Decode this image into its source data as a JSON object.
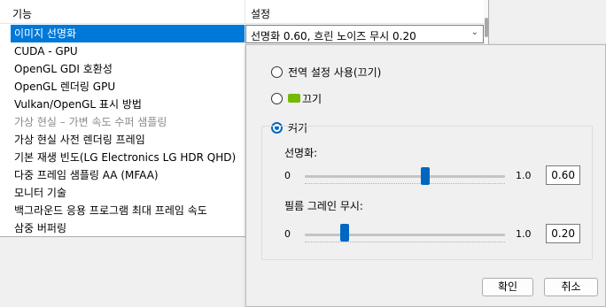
{
  "grid": {
    "col_name": "기능",
    "col_value": "설정",
    "rows": [
      {
        "label": "이미지 선명화",
        "state": "selected"
      },
      {
        "label": "CUDA - GPU",
        "state": "normal"
      },
      {
        "label": "OpenGL GDI 호환성",
        "state": "normal"
      },
      {
        "label": "OpenGL 렌더링 GPU",
        "state": "normal"
      },
      {
        "label": "Vulkan/OpenGL 표시 방법",
        "state": "normal"
      },
      {
        "label": "가상 현실 – 가변 속도 수퍼 샘플링",
        "state": "disabled"
      },
      {
        "label": "가상 현실 사전 렌더링 프레임",
        "state": "normal"
      },
      {
        "label": "기본 재생 빈도(LG Electronics LG HDR QHD)",
        "state": "normal"
      },
      {
        "label": "다중 프레임 샘플링 AA (MFAA)",
        "state": "normal"
      },
      {
        "label": "모니터 기술",
        "state": "normal"
      },
      {
        "label": "백그라운드 응용 프로그램 최대 프레임 속도",
        "state": "normal"
      },
      {
        "label": "삼중 버퍼링",
        "state": "normal"
      }
    ],
    "selected_value": "선명화 0.60, 흐린 노이즈 무시 0.20",
    "dropdown_icon": "chevron-down-icon"
  },
  "popup": {
    "options": [
      {
        "label": "전역 설정 사용(끄기)",
        "checked": false
      },
      {
        "label": "끄기",
        "checked": false,
        "icon": "nvidia-logo-icon"
      },
      {
        "label": "켜기",
        "checked": true
      }
    ],
    "sharpen": {
      "label": "선명화:",
      "min": "0",
      "max": "1.0",
      "value": "0.60",
      "level": 0.6
    },
    "grain": {
      "label": "필름 그레인 무시:",
      "min": "0",
      "max": "1.0",
      "value": "0.20",
      "level": 0.2
    },
    "ok_label": "확인",
    "cancel_label": "취소",
    "accent": "#0067c0"
  },
  "colors": {
    "selection": "#0078d7",
    "nvidia_green": "#76b900"
  }
}
